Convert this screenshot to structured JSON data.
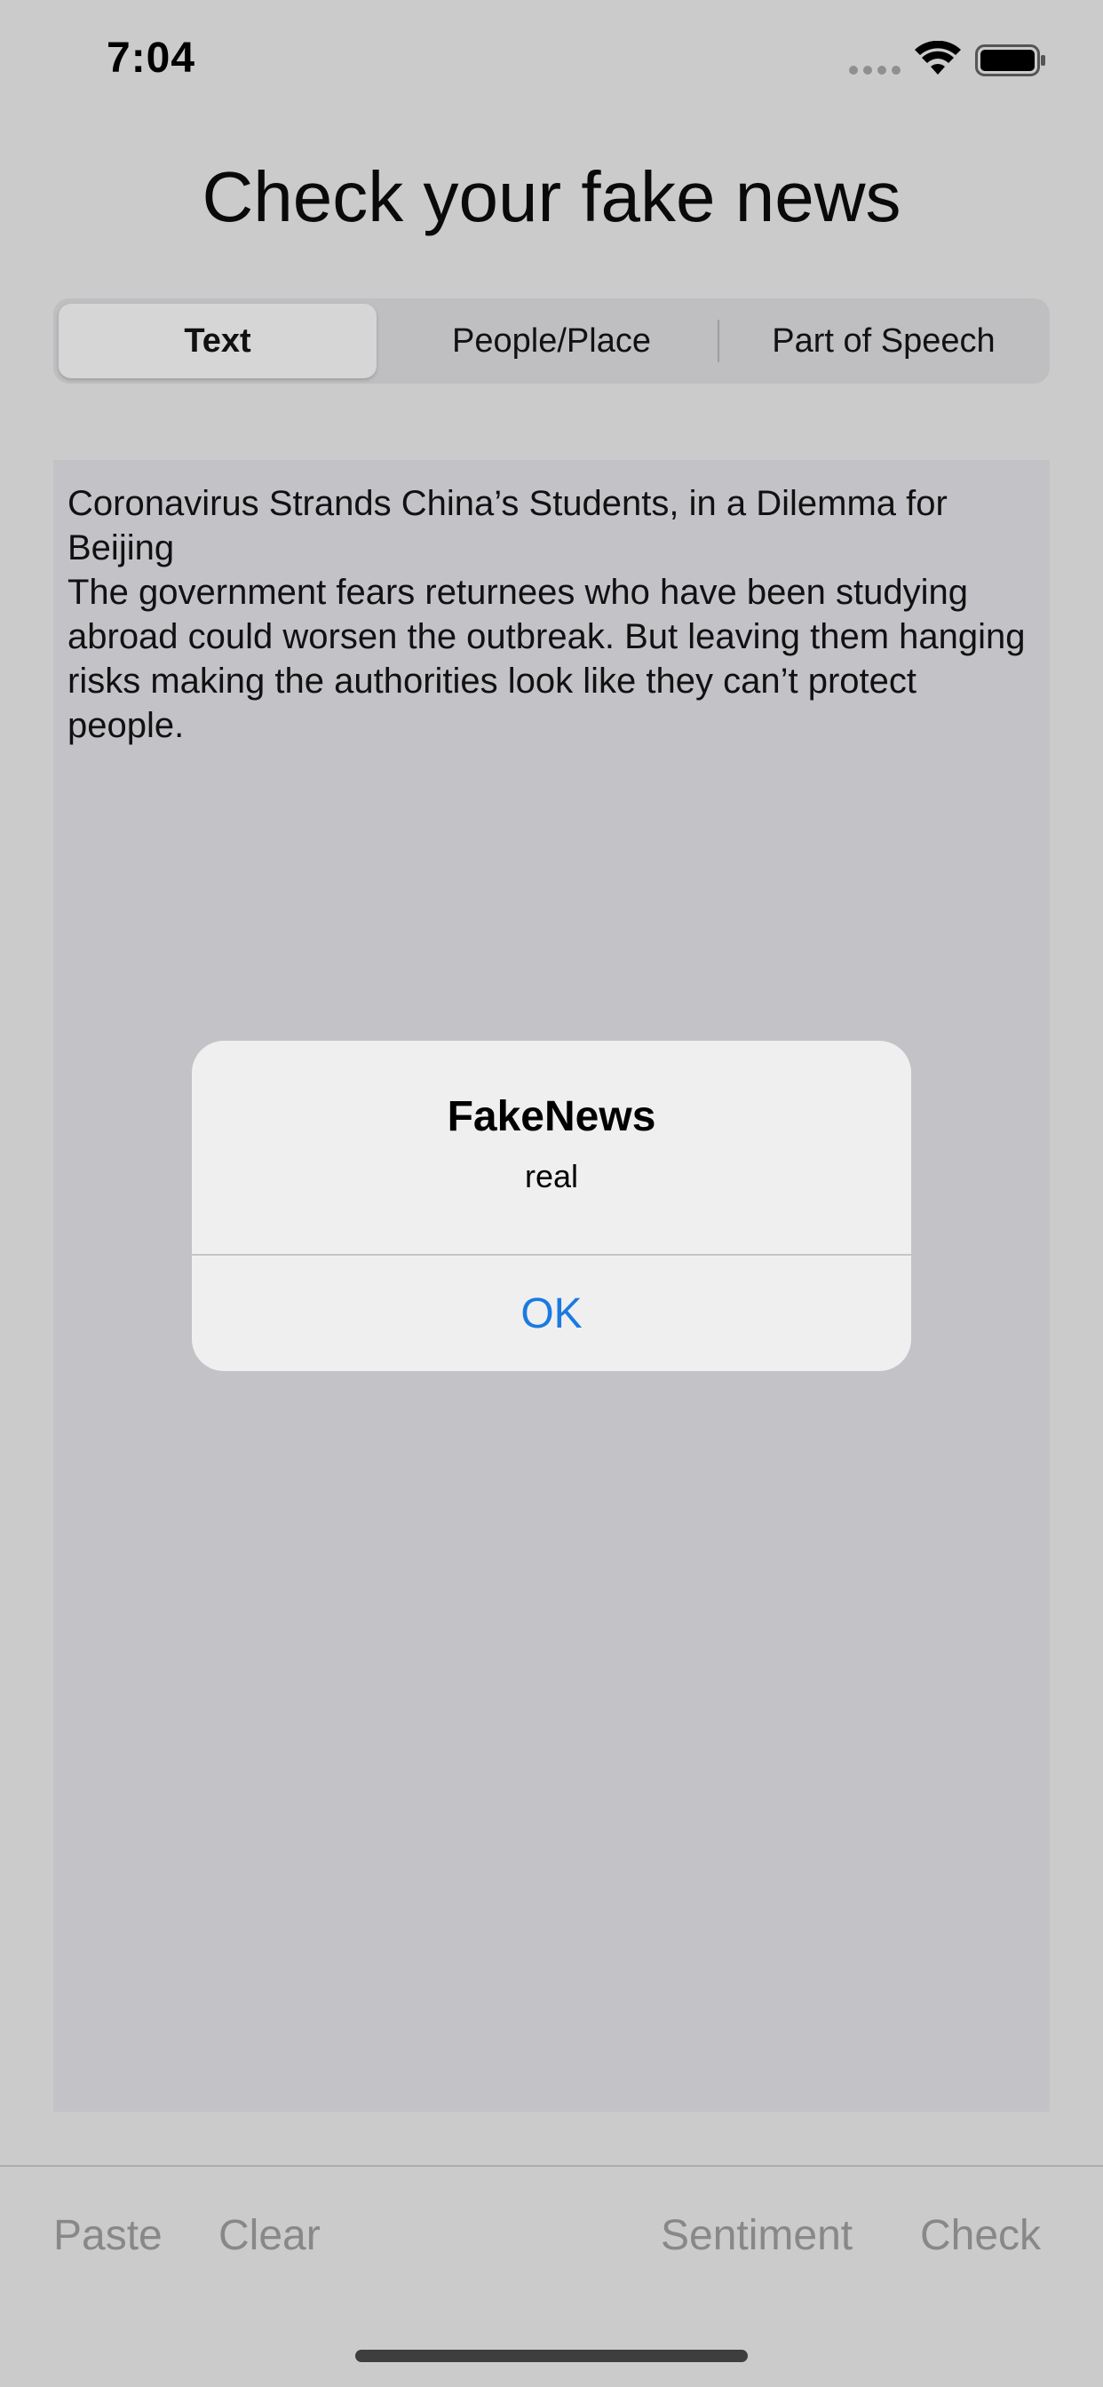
{
  "status_bar": {
    "time": "7:04",
    "icons": [
      "signal-dots-icon",
      "wifi-icon",
      "battery-icon"
    ]
  },
  "header": {
    "title": "Check your fake news"
  },
  "segmented_control": {
    "segments": [
      {
        "label": "Text",
        "selected": true
      },
      {
        "label": "People/Place",
        "selected": false
      },
      {
        "label": "Part of Speech",
        "selected": false
      }
    ]
  },
  "text_view": {
    "content": "Coronavirus Strands China’s Students, in a Dilemma for Beijing\nThe government fears returnees who have been studying abroad could worsen the outbreak. But leaving them hanging risks making the authorities look like they can’t protect people."
  },
  "alert": {
    "title": "FakeNews",
    "message": "real",
    "ok_label": "OK"
  },
  "toolbar": {
    "paste_label": "Paste",
    "clear_label": "Clear",
    "sentiment_label": "Sentiment",
    "check_label": "Check"
  },
  "colors": {
    "background": "#cbcbcb",
    "alert_button": "#1a7ae0",
    "toolbar_text": "#888888"
  }
}
